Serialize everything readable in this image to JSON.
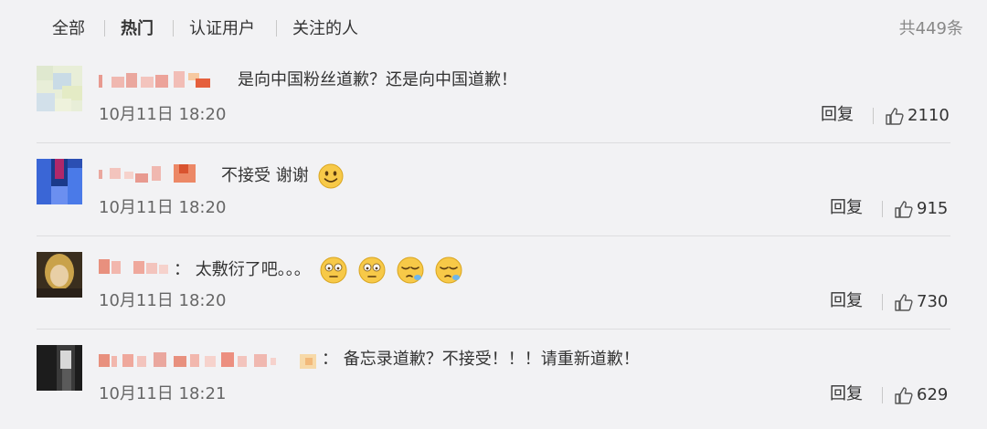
{
  "tabs": [
    {
      "label": "全部",
      "active": false
    },
    {
      "label": "热门",
      "active": true
    },
    {
      "label": "认证用户",
      "active": false
    },
    {
      "label": "关注的人",
      "active": false
    }
  ],
  "total_count": "共449条",
  "comments": [
    {
      "text": "是向中国粉丝道歉？还是向中国道歉！",
      "time": "10月11日 18:20",
      "reply": "回复",
      "likes": "2110"
    },
    {
      "text": "不接受 谢谢",
      "emoji": [
        "smile-emoji"
      ],
      "time": "10月11日 18:20",
      "reply": "回复",
      "likes": "915"
    },
    {
      "text": "：  太敷衍了吧。。。",
      "emoji": [
        "dizzy-emoji",
        "dizzy-emoji",
        "sleepy-emoji",
        "sleepy-emoji"
      ],
      "time": "10月11日 18:20",
      "reply": "回复",
      "likes": "730"
    },
    {
      "text": "：  备忘录道歉？不接受！！！请重新道歉！",
      "time": "10月11日 18:21",
      "reply": "回复",
      "likes": "629"
    }
  ],
  "colors": {
    "background": "#f2f2f4",
    "text": "#333333",
    "muted": "#666666",
    "emoji": "#f7c948"
  }
}
